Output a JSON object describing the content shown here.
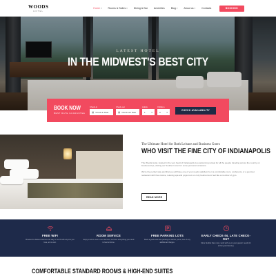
{
  "header": {
    "logo_main": "WOODS",
    "logo_sub": "HOTEL",
    "nav": [
      {
        "label": "Home",
        "active": true,
        "dropdown": true
      },
      {
        "label": "Rooms & Suites",
        "active": false,
        "dropdown": true
      },
      {
        "label": "Dining & Bar",
        "active": false,
        "dropdown": false
      },
      {
        "label": "Amenities",
        "active": false,
        "dropdown": false
      },
      {
        "label": "Blog",
        "active": false,
        "dropdown": true
      },
      {
        "label": "About us",
        "active": false,
        "dropdown": true
      },
      {
        "label": "Contacts",
        "active": false,
        "dropdown": false
      }
    ],
    "booking_label": "BOOKING"
  },
  "hero": {
    "subtitle": "LATEST HOTEL",
    "title": "IN THE MIDWEST'S BEST CITY"
  },
  "booking_bar": {
    "title": "BOOK NOW",
    "subtitle": "BEST RATE GUARANTEE",
    "fields": [
      {
        "label": "Check-in",
        "value": "Check-in Date",
        "icon": "calendar-icon"
      },
      {
        "label": "Check-out",
        "value": "Check-out Date",
        "icon": "calendar-icon"
      },
      {
        "label": "Adults",
        "value": "1",
        "icon": "chevron-down-icon"
      },
      {
        "label": "Children",
        "value": "0",
        "icon": "chevron-down-icon"
      }
    ],
    "button_label": "CHECK AVAILABILITY"
  },
  "about": {
    "eyebrow": "The Ultimate Hotel for Both Leisure and Business Goers",
    "title": "WHO VISIT THE FINE CITY OF INDIANAPOLIS",
    "paragraph1": "The Woods Hotel, located in the very heart of Indianapolis is a welcoming retreat for all the people traveling across the country on business trips, visiting our Southern town for some personal occasions.",
    "paragraph2": "We're the perfect stay and that you will have one of your needs satisfied, be it a comfortable room, conference or a gourmet restaurant with fine cuisine, relaxing spa and yoga room or cozy bedrooms to feel like a member of gym.",
    "button_label": "READ MORE"
  },
  "features": [
    {
      "icon": "wifi-icon",
      "title": "FREE WIFI",
      "desc": "Browse the fastest internet and stay in touch with anyone you love, at no cost."
    },
    {
      "icon": "room-service-icon",
      "title": "ROOM SERVICE",
      "desc": "Enjoy a full in-room menu service, we have everything you need to feel at home."
    },
    {
      "icon": "parking-icon",
      "title": "FREE PARKING LOTS",
      "desc": "Book a guide and free parking lot will be yours, free of any additional charges."
    },
    {
      "icon": "clock-icon",
      "title": "EARLY CHECK-IN, LATE CHECK-OUT",
      "desc": "More flexible than most, work with us on your guests' needs for arriving and leaving."
    }
  ],
  "rooms_section": {
    "title": "COMFORTABLE STANDARD ROOMS & HIGH-END SUITES"
  },
  "colors": {
    "accent": "#f24a5f",
    "navy": "#1e2a4a"
  }
}
